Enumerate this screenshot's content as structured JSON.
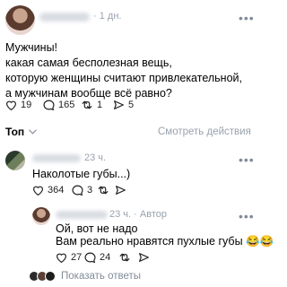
{
  "post": {
    "time": "1 дн.",
    "lines": [
      "Мужчины!",
      "какая самая бесполезная вещь,",
      "которую женщины считают привлекательной,",
      "а мужчинам вообще всё равно?"
    ],
    "likes": "19",
    "comments": "165",
    "reposts": "1",
    "views": "5"
  },
  "sort": {
    "label": "Топ",
    "actions_label": "Смотреть действия"
  },
  "comment1": {
    "time": "23 ч.",
    "text": "Наколотые губы...)",
    "likes": "364",
    "replies": "3"
  },
  "reply1": {
    "time": "23 ч.",
    "author_badge": "Автор",
    "line1": "Ой, вот не надо",
    "line2": "Вам реально нравятся пухлые губы",
    "emoji": "😂😂",
    "likes": "27",
    "replies": "24"
  },
  "show_replies": {
    "label": "Показать ответы"
  },
  "colors": {
    "accent": "#2688eb",
    "muted": "#99a2ad",
    "icon": "#222222"
  }
}
